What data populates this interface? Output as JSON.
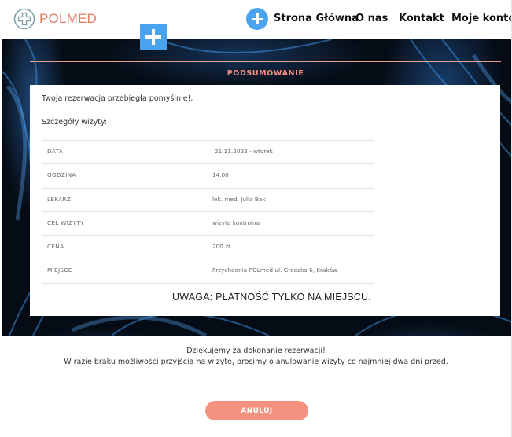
{
  "header": {
    "logo_text": "POLMED",
    "nav": {
      "home": "Strona Główna",
      "about": "O nas",
      "contact": "Kontakt",
      "account": "Moje konto"
    }
  },
  "summary": {
    "title": "PODSUMOWANIE",
    "success_message": "Twoja rezerwacja przebiegła pomyślnie!.",
    "details_label": "Szczegóły wizyty:",
    "rows": [
      {
        "label": "DATA",
        "value": "21.11.2022 - wtorek"
      },
      {
        "label": "GODZINA",
        "value": "14.00"
      },
      {
        "label": "LEKARZ",
        "value": "lek. med. Julia Bak"
      },
      {
        "label": "CEL WIZYTY",
        "value": "wizyta kontrolna"
      },
      {
        "label": "CENA",
        "value": "200 zł"
      },
      {
        "label": "MIEJSCE",
        "value": "Przychodnia POLmed ul. Grodzka 6, Kraków"
      }
    ],
    "warning": "UWAGA: PŁATNOŚĆ TYLKO NA MIEJSCU."
  },
  "footer": {
    "thanks_line1": "Dziękujemy za dokonanie rezerwacji!",
    "thanks_line2": "W razie braku możliwości przyjścia na wizytę, prosimy o anulowanie wizyty co najmniej dwa dni przed.",
    "cancel_label": "ANULUJ"
  },
  "icons": {
    "logo": "medical-cross-circle-icon",
    "nav_plus": "plus-circle-icon",
    "floating_plus": "plus-square-icon"
  },
  "colors": {
    "brand": "#e77b64",
    "accent_blue": "#4aa3ee",
    "button": "#f4917f",
    "hero_bg": "#060c15"
  }
}
